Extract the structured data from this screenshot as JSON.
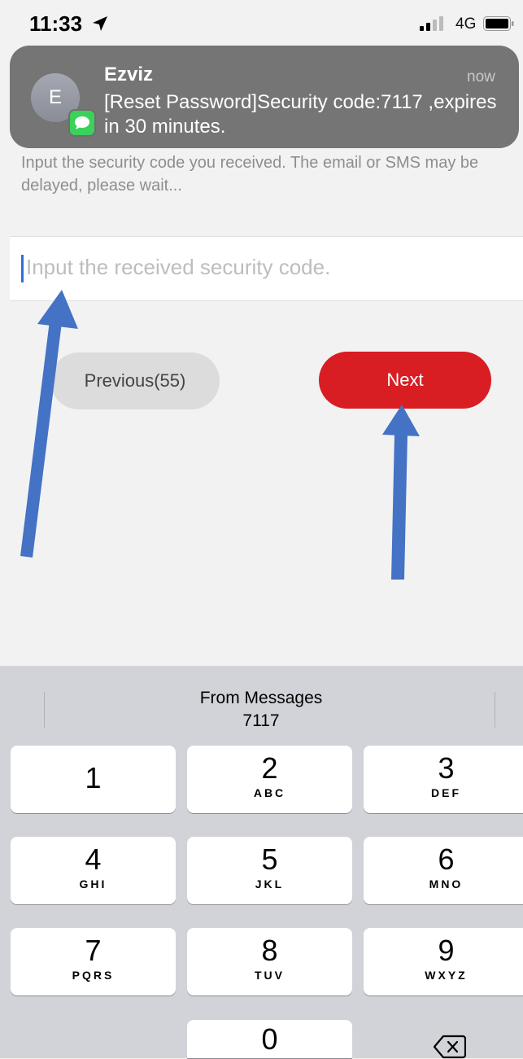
{
  "status_bar": {
    "time": "11:33",
    "location_icon": "location-arrow-icon",
    "network": "4G",
    "signal_icon": "signal-bars-icon",
    "battery_icon": "battery-icon"
  },
  "notification": {
    "app": "Ezviz",
    "time": "now",
    "avatar_initial": "E",
    "body": "[Reset Password]Security code:7117 ,expires in 30 minutes.",
    "badge_icon": "messages-icon",
    "badge_color": "#3bd15a"
  },
  "page": {
    "instruction": "Input the security code you received. The email or SMS may be delayed, please wait...",
    "code_input_placeholder": "Input the received security code.",
    "previous_label": "Previous(55)",
    "next_label": "Next",
    "accent_color": "#d81d23"
  },
  "keyboard": {
    "suggestion_title": "From Messages",
    "suggestion_code": "7117",
    "keys": [
      {
        "num": "1",
        "letters": ""
      },
      {
        "num": "2",
        "letters": "ABC"
      },
      {
        "num": "3",
        "letters": "DEF"
      },
      {
        "num": "4",
        "letters": "GHI"
      },
      {
        "num": "5",
        "letters": "JKL"
      },
      {
        "num": "6",
        "letters": "MNO"
      },
      {
        "num": "7",
        "letters": "PQRS"
      },
      {
        "num": "8",
        "letters": "TUV"
      },
      {
        "num": "9",
        "letters": "WXYZ"
      },
      {
        "num": "0",
        "letters": ""
      }
    ],
    "delete_icon": "backspace-icon"
  },
  "annotations": {
    "arrow_color": "#4472c4",
    "arrow_icon": "annotation-arrow-icon"
  }
}
